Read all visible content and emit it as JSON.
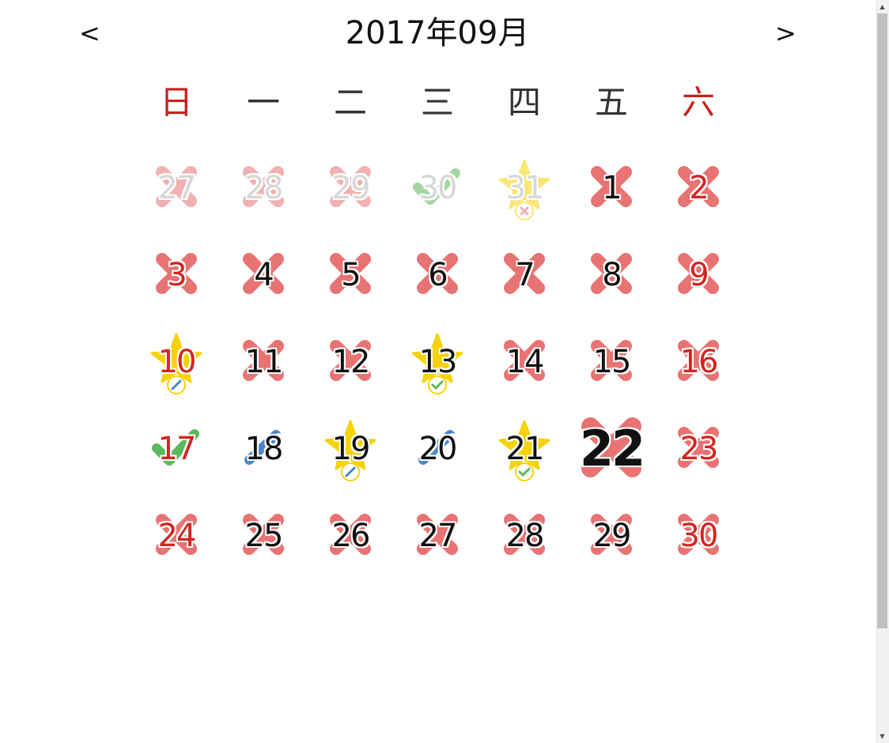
{
  "header": {
    "prev_label": "<",
    "next_label": ">",
    "month_title": "2017年09月"
  },
  "weekdays": [
    "日",
    "一",
    "二",
    "三",
    "四",
    "五",
    "六"
  ],
  "colors": {
    "cross": "#e87373",
    "star": "#f5d20a",
    "check_green": "#5cb85c",
    "pencil_blue": "#4a86c8",
    "weekend_red": "#c8221c"
  },
  "calendar": {
    "days": [
      {
        "label": "27",
        "other": true,
        "red": true,
        "mark": "cross"
      },
      {
        "label": "28",
        "other": true,
        "red": false,
        "mark": "cross"
      },
      {
        "label": "29",
        "other": true,
        "red": false,
        "mark": "cross"
      },
      {
        "label": "30",
        "other": true,
        "red": false,
        "mark": "check"
      },
      {
        "label": "31",
        "other": true,
        "red": false,
        "mark": "star",
        "badge": "x"
      },
      {
        "label": "1",
        "other": false,
        "red": false,
        "mark": "cross"
      },
      {
        "label": "2",
        "other": false,
        "red": true,
        "mark": "cross"
      },
      {
        "label": "3",
        "other": false,
        "red": true,
        "mark": "cross"
      },
      {
        "label": "4",
        "other": false,
        "red": false,
        "mark": "cross"
      },
      {
        "label": "5",
        "other": false,
        "red": false,
        "mark": "cross"
      },
      {
        "label": "6",
        "other": false,
        "red": false,
        "mark": "cross"
      },
      {
        "label": "7",
        "other": false,
        "red": false,
        "mark": "cross"
      },
      {
        "label": "8",
        "other": false,
        "red": false,
        "mark": "cross"
      },
      {
        "label": "9",
        "other": false,
        "red": true,
        "mark": "cross"
      },
      {
        "label": "10",
        "other": false,
        "red": true,
        "mark": "star",
        "badge": "pencil"
      },
      {
        "label": "11",
        "other": false,
        "red": false,
        "mark": "cross"
      },
      {
        "label": "12",
        "other": false,
        "red": false,
        "mark": "cross"
      },
      {
        "label": "13",
        "other": false,
        "red": false,
        "mark": "star",
        "badge": "check"
      },
      {
        "label": "14",
        "other": false,
        "red": false,
        "mark": "cross"
      },
      {
        "label": "15",
        "other": false,
        "red": false,
        "mark": "cross"
      },
      {
        "label": "16",
        "other": false,
        "red": true,
        "mark": "cross"
      },
      {
        "label": "17",
        "other": false,
        "red": true,
        "mark": "check"
      },
      {
        "label": "18",
        "other": false,
        "red": false,
        "mark": "pencil"
      },
      {
        "label": "19",
        "other": false,
        "red": false,
        "mark": "star",
        "badge": "pencil"
      },
      {
        "label": "20",
        "other": false,
        "red": false,
        "mark": "pencil"
      },
      {
        "label": "21",
        "other": false,
        "red": false,
        "mark": "star",
        "badge": "check"
      },
      {
        "label": "22",
        "other": false,
        "red": false,
        "mark": "cross",
        "today": true
      },
      {
        "label": "23",
        "other": false,
        "red": true,
        "mark": "cross"
      },
      {
        "label": "24",
        "other": false,
        "red": true,
        "mark": "cross"
      },
      {
        "label": "25",
        "other": false,
        "red": false,
        "mark": "cross"
      },
      {
        "label": "26",
        "other": false,
        "red": false,
        "mark": "cross"
      },
      {
        "label": "27",
        "other": false,
        "red": false,
        "mark": "cross"
      },
      {
        "label": "28",
        "other": false,
        "red": false,
        "mark": "cross"
      },
      {
        "label": "29",
        "other": false,
        "red": false,
        "mark": "cross"
      },
      {
        "label": "30",
        "other": false,
        "red": true,
        "mark": "cross"
      }
    ]
  },
  "scrollbar": {
    "up_arrow": "▲",
    "down_arrow": "▼"
  }
}
